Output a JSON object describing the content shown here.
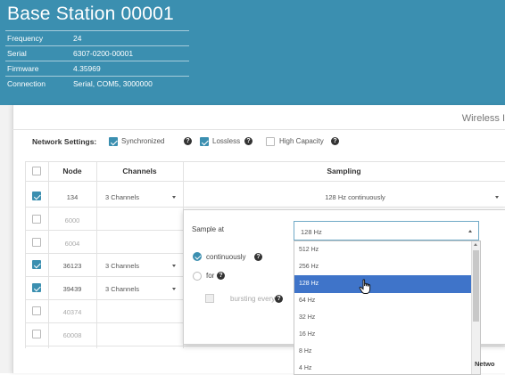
{
  "header": {
    "title": "Base Station 00001",
    "info": [
      {
        "key": "Frequency",
        "value": "24"
      },
      {
        "key": "Serial",
        "value": "6307-0200-00001"
      },
      {
        "key": "Firmware",
        "value": "4.35969"
      },
      {
        "key": "Connection",
        "value": "Serial, COM5, 3000000"
      }
    ]
  },
  "panel": {
    "title_partial": "Wireless I"
  },
  "network_settings": {
    "label": "Network Settings:",
    "options": [
      {
        "label": "Synchronized",
        "checked": true
      },
      {
        "label": "Lossless",
        "checked": true
      },
      {
        "label": "High Capacity",
        "checked": false
      }
    ]
  },
  "table": {
    "headers": {
      "node": "Node",
      "channels": "Channels",
      "sampling": "Sampling"
    },
    "rows": [
      {
        "checked": true,
        "node": "134",
        "channels": "3 Channels",
        "sampling": "128 Hz continuously",
        "dim": false
      },
      {
        "checked": false,
        "node": "6000",
        "channels": "",
        "sampling": "",
        "dim": true
      },
      {
        "checked": false,
        "node": "6004",
        "channels": "",
        "sampling": "",
        "dim": true
      },
      {
        "checked": true,
        "node": "36123",
        "channels": "3 Channels",
        "sampling": "",
        "dim": false
      },
      {
        "checked": true,
        "node": "39439",
        "channels": "3 Channels",
        "sampling": "",
        "dim": false
      },
      {
        "checked": false,
        "node": "40374",
        "channels": "",
        "sampling": "",
        "dim": true
      },
      {
        "checked": false,
        "node": "60008",
        "channels": "",
        "sampling": "",
        "dim": true
      }
    ]
  },
  "sample_popup": {
    "sample_at_label": "Sample at",
    "selected_rate": "128 Hz",
    "continuously_label": "continuously",
    "for_label": "for",
    "bursting_label": "bursting every",
    "rates": [
      "512 Hz",
      "256 Hz",
      "128 Hz",
      "64 Hz",
      "32 Hz",
      "16 Hz",
      "8 Hz",
      "4 Hz"
    ],
    "highlighted_index": 2
  },
  "footer": {
    "partial_text": "Netwo"
  },
  "colors": {
    "header_bg": "#3b8fb0",
    "accent": "#3b8fb0",
    "dropdown_highlight": "#3f74c9"
  }
}
